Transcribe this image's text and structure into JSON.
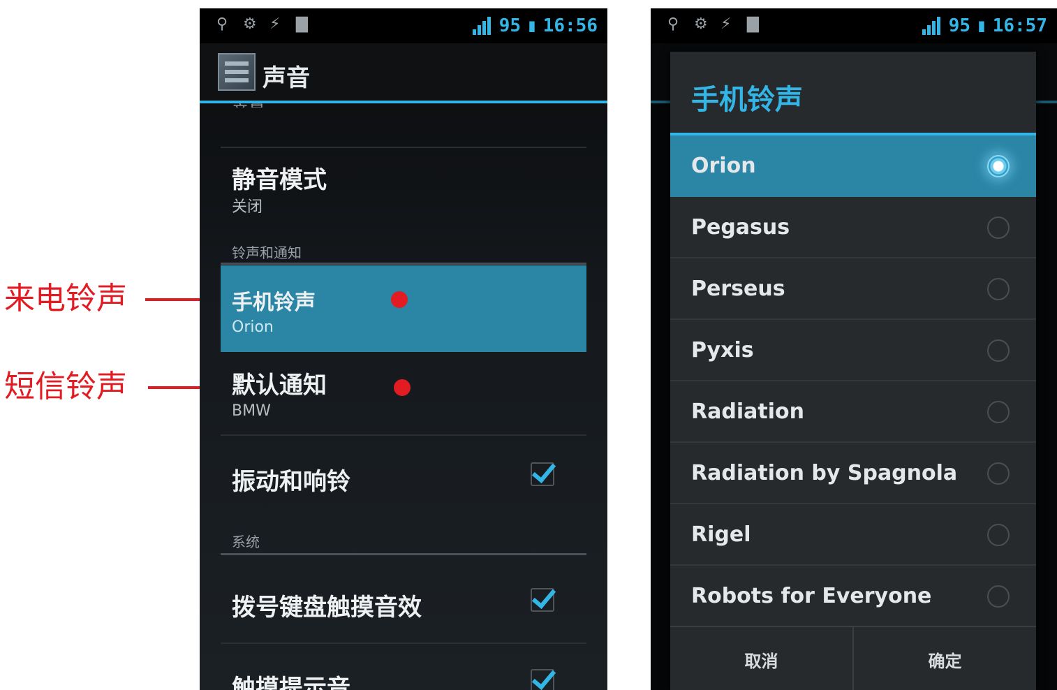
{
  "annotations": {
    "incoming_call_ringtone": "来电铃声",
    "sms_ringtone": "短信铃声",
    "color": "#e31b23"
  },
  "left_screen": {
    "status_bar": {
      "icons": [
        "usb-icon",
        "android-debug-icon",
        "usb-storage-icon",
        "message-icon"
      ],
      "battery": "95",
      "time": "16:56"
    },
    "action_bar": {
      "title": "声音"
    },
    "peek_text": "音量",
    "items": {
      "silent_mode": {
        "title": "静音模式",
        "summary": "关闭"
      },
      "section_ringtone": "铃声和通知",
      "phone_ringtone": {
        "title": "手机铃声",
        "summary": "Orion"
      },
      "default_notification": {
        "title": "默认通知",
        "summary": "BMW"
      },
      "vibrate_ring": {
        "title": "振动和响铃",
        "checked": true
      },
      "section_system": "系统",
      "dial_pad_tones": {
        "title": "拨号键盘触摸音效",
        "checked": true
      },
      "touch_sounds": {
        "title": "触摸提示音",
        "checked": true
      }
    }
  },
  "right_screen": {
    "status_bar": {
      "icons": [
        "usb-icon",
        "android-debug-icon",
        "usb-storage-icon",
        "message-icon"
      ],
      "battery": "95",
      "time": "16:57"
    },
    "dialog": {
      "title": "手机铃声",
      "options": [
        {
          "label": "Orion",
          "selected": true
        },
        {
          "label": "Pegasus",
          "selected": false
        },
        {
          "label": "Perseus",
          "selected": false
        },
        {
          "label": "Pyxis",
          "selected": false
        },
        {
          "label": "Radiation",
          "selected": false
        },
        {
          "label": "Radiation by Spagnola",
          "selected": false
        },
        {
          "label": "Rigel",
          "selected": false
        },
        {
          "label": "Robots for Everyone",
          "selected": false
        }
      ],
      "cancel_label": "取消",
      "ok_label": "确定"
    }
  },
  "colors": {
    "accent": "#33b5e5",
    "selection": "#2b86a6"
  }
}
